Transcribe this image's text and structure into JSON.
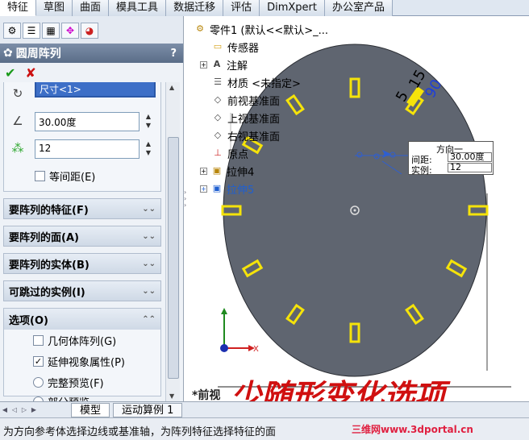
{
  "tabs": [
    "特征",
    "草图",
    "曲面",
    "模具工具",
    "数据迁移",
    "评估",
    "DimXpert",
    "办公室产品"
  ],
  "feature": {
    "title": "圆周阵列",
    "help": "?"
  },
  "direction": {
    "reference_field": "尺寸<1>",
    "angle_value": "30.00度",
    "count_value": "12",
    "equal_spacing_label": "等间距(E)"
  },
  "sections": {
    "features_to_pattern": "要阵列的特征(F)",
    "faces_to_pattern": "要阵列的面(A)",
    "bodies_to_pattern": "要阵列的实体(B)",
    "instances_to_skip": "可跳过的实例(I)",
    "options": "选项(O)"
  },
  "options": {
    "geometry_pattern": "几何体阵列(G)",
    "propagate_visual": "延伸视象属性(P)",
    "full_preview": "完整预览(F)",
    "partial_preview": "部分预览"
  },
  "tree": {
    "root": "零件1 (默认<<默认>_...",
    "items": [
      "传感器",
      "注解",
      "材质 <未指定>",
      "前视基准面",
      "上视基准面",
      "右视基准面",
      "原点",
      "拉伸4",
      "拉伸5"
    ]
  },
  "callout": {
    "title": "方向一",
    "spacing_label": "间距:",
    "spacing_value": "30.00度",
    "instances_label": "实例:",
    "instances_value": "12"
  },
  "dimensions": {
    "five": "5",
    "label": "15",
    "ninety": "90"
  },
  "view": {
    "name": "*前视",
    "axis_x": "X"
  },
  "annotations": {
    "question": "???",
    "note": "少随形变化选项"
  },
  "bottom_tabs": [
    "模型",
    "运动算例 1"
  ],
  "status_text": "为方向参考体选择边线或基准轴，为阵列特征选择特征的面",
  "watermark": "三维网www.3dportal.cn",
  "colors": {
    "disk": "#5f6570",
    "slot": "#f5e30a",
    "header": "#6c7f9b"
  }
}
